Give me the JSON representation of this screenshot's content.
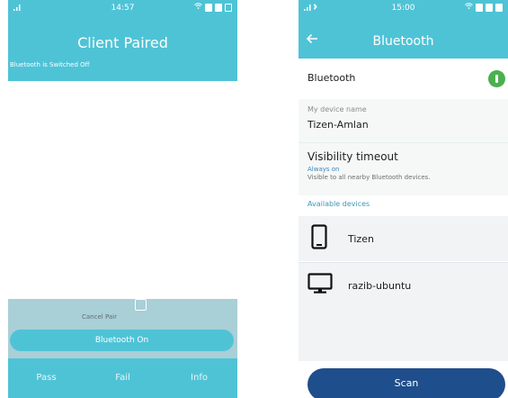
{
  "colors": {
    "accent": "#4fc3d6",
    "toggle_on": "#4caf50",
    "scan_button": "#1f4e8c",
    "link_blue": "#3a86b8"
  },
  "left_phone": {
    "status": {
      "time": "14:57"
    },
    "title": "Client Paired",
    "subtitle": "Bluetooth is Switched Off",
    "cancel_pair_label": "Cancel Pair",
    "bluetooth_button": "Bluetooth On",
    "tabs": [
      {
        "label": "Pass"
      },
      {
        "label": "Fail"
      },
      {
        "label": "Info"
      }
    ]
  },
  "right_phone": {
    "status": {
      "time": "15:00"
    },
    "title": "Bluetooth",
    "bluetooth_label": "Bluetooth",
    "bluetooth_enabled": true,
    "device_name_caption": "My device name",
    "device_name": "Tizen-Amlan",
    "visibility_title": "Visibility timeout",
    "visibility_value": "Always on",
    "visibility_desc": "Visible to all nearby Bluetooth devices.",
    "available_header": "Available devices",
    "devices": [
      {
        "name": "Tizen",
        "icon": "smartphone-icon"
      },
      {
        "name": "razib-ubuntu",
        "icon": "monitor-icon"
      }
    ],
    "scan_button": "Scan"
  }
}
